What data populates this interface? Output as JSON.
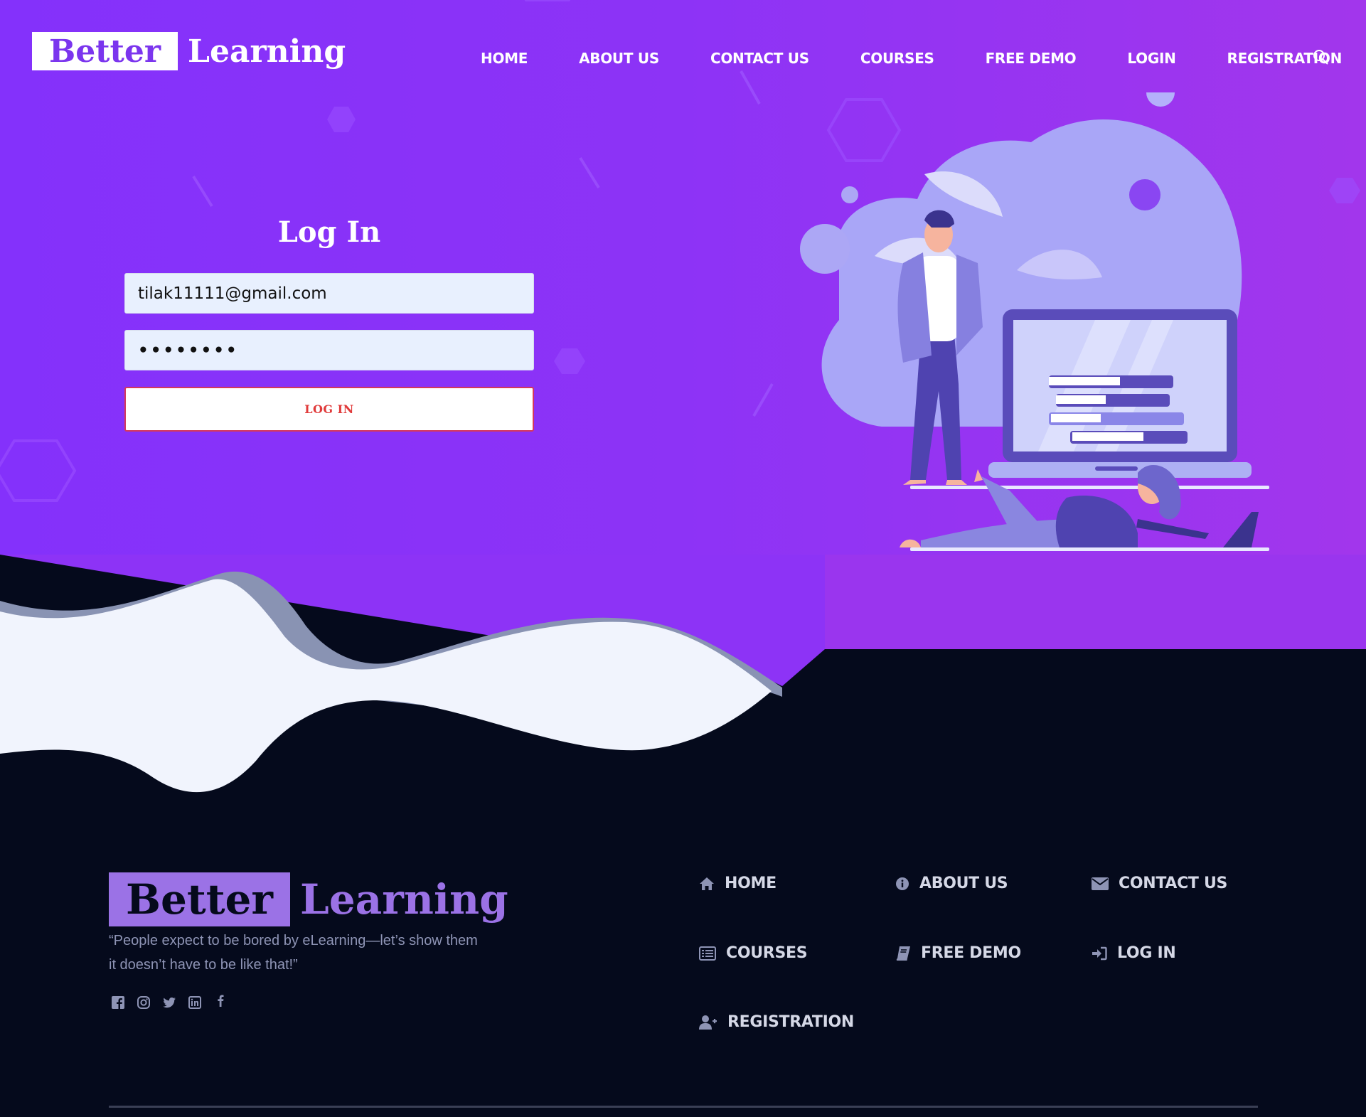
{
  "header": {
    "logo_part1": "Better",
    "logo_part2": "Learning",
    "nav": [
      "HOME",
      "ABOUT US",
      "CONTACT US",
      "COURSES",
      "FREE DEMO",
      "LOGIN",
      "REGISTRATION"
    ]
  },
  "login": {
    "title": "Log In",
    "email_value": "tilak11111@gmail.com",
    "password_value": "••••••••",
    "button_label": "LOG IN"
  },
  "footer": {
    "logo_part1": "Better",
    "logo_part2": "Learning",
    "tagline": "“People expect to be bored by eLearning—let’s show them it doesn’t have to be like that!”",
    "links": {
      "home": "HOME",
      "about": "ABOUT US",
      "contact": "CONTACT US",
      "courses": "COURSES",
      "demo": "FREE DEMO",
      "login": "LOG IN",
      "registration": "REGISTRATION"
    },
    "social_icons": [
      "facebook-icon",
      "instagram-icon",
      "twitter-icon",
      "linkedin-icon",
      "facebook-f-icon"
    ]
  },
  "colors": {
    "hero_purple": "#8431fb",
    "hero_purple_right": "#a236ec",
    "footer_bg": "#050a1c",
    "accent_lavender": "#9b72e6",
    "login_button_text": "#e03a3a"
  }
}
